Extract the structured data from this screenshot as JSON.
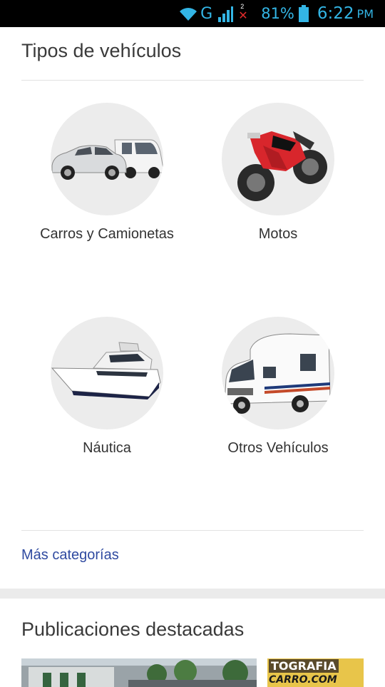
{
  "status_bar": {
    "network_type": "G",
    "sim2_label": "2",
    "battery_percent": "81%",
    "time": "6:22",
    "ampm": "PM"
  },
  "vehicle_types": {
    "title": "Tipos de vehículos",
    "categories": [
      {
        "label": "Carros y Camionetas",
        "icon": "car-van-image"
      },
      {
        "label": "Motos",
        "icon": "motorcycle-image"
      },
      {
        "label": "Náutica",
        "icon": "yacht-image"
      },
      {
        "label": "Otros Vehículos",
        "icon": "motorhome-image"
      }
    ],
    "more_link": "Más categorías"
  },
  "featured": {
    "title": "Publicaciones destacadas",
    "thumb2_text_line1": "TOGRAFIA",
    "thumb2_text_line2": "CARRO.COM"
  },
  "colors": {
    "status_accent": "#33b5e5",
    "link": "#2f4aa0",
    "circle_bg": "#ececec",
    "moto_red": "#d8262c"
  }
}
